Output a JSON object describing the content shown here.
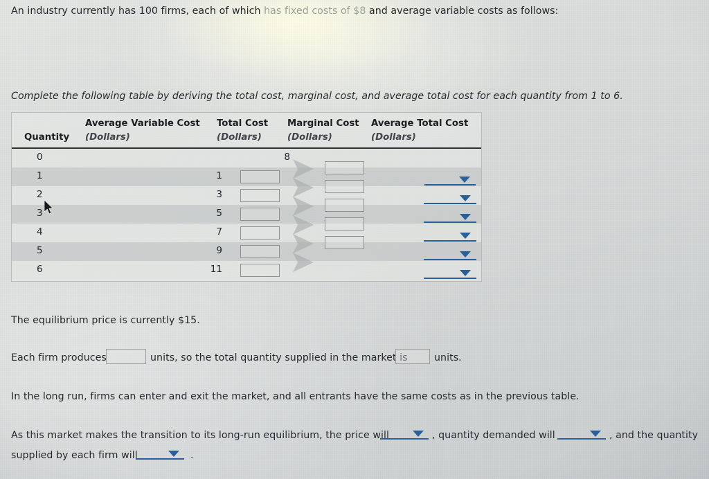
{
  "intro": {
    "line1_a": "An industry currently has 100 firms, each of which ",
    "line1_b": "has fixed costs of $8",
    "line1_c": " and average variable costs as follows:",
    "instruction": "Complete the following table by deriving the total cost, marginal cost, and average total cost for each quantity from 1 to 6."
  },
  "table": {
    "headers": {
      "quantity": "Quantity",
      "avc_title": "Average Variable Cost",
      "avc_unit": "(Dollars)",
      "tc_title": "Total Cost",
      "tc_unit": "(Dollars)",
      "mc_title": "Marginal Cost",
      "mc_unit": "(Dollars)",
      "atc_title": "Average Total Cost",
      "atc_unit": "(Dollars)"
    },
    "rows": [
      {
        "quantity": "0",
        "avc": "",
        "total_cost": "8",
        "tc_input": false,
        "mc_input": false,
        "atc_dropdown": false
      },
      {
        "quantity": "1",
        "avc": "1",
        "total_cost": "",
        "tc_input": true,
        "mc_input": true,
        "atc_dropdown": true
      },
      {
        "quantity": "2",
        "avc": "3",
        "total_cost": "",
        "tc_input": true,
        "mc_input": true,
        "atc_dropdown": true
      },
      {
        "quantity": "3",
        "avc": "5",
        "total_cost": "",
        "tc_input": true,
        "mc_input": true,
        "atc_dropdown": true
      },
      {
        "quantity": "4",
        "avc": "7",
        "total_cost": "",
        "tc_input": true,
        "mc_input": true,
        "atc_dropdown": true
      },
      {
        "quantity": "5",
        "avc": "9",
        "total_cost": "",
        "tc_input": true,
        "mc_input": true,
        "atc_dropdown": true
      },
      {
        "quantity": "6",
        "avc": "11",
        "total_cost": "",
        "tc_input": true,
        "mc_input": false,
        "atc_dropdown": true
      }
    ],
    "marginal_arrow_count": 6,
    "input_value": "",
    "input_placeholder": ""
  },
  "body": {
    "equilibrium": "The equilibrium price is currently $15.",
    "supply_a": "Each firm produces",
    "supply_b": "units, so the total quantity supplied in the market is",
    "supply_c": "units.",
    "longrun": "In the long run, firms can enter and exit the market, and all entrants have the same costs as in the previous table.",
    "transition_a": "As this market makes the transition to its long-run equilibrium, the price will",
    "transition_b": ", quantity demanded will",
    "transition_c": ", and the quantity",
    "transition_d": "supplied by each firm will",
    "transition_e": "."
  },
  "inputs": {
    "firm_output": "",
    "market_quantity": ""
  },
  "colors": {
    "dropdown_blue": "#2a6099",
    "text": "#23262a",
    "rule": "#2d3033",
    "box_border": "#8d9193"
  },
  "icons": {
    "dropdown": "caret-down-icon",
    "marginal": "chevron-right-icon",
    "cursor": "mouse-pointer-icon"
  }
}
